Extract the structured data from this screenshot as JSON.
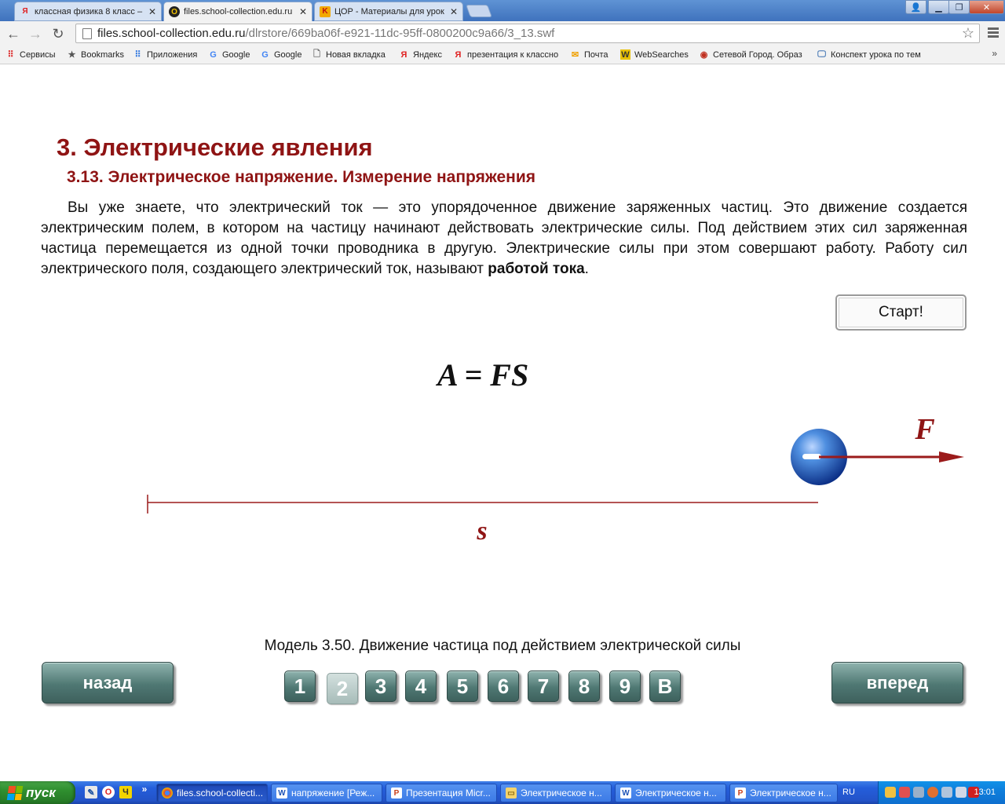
{
  "tabs": [
    {
      "title": "классная физика 8 класс –",
      "favicon": "yandex-icon"
    },
    {
      "title": "files.school-collection.edu.ru",
      "favicon": "collection-icon"
    },
    {
      "title": "ЦОР - Материалы для урок",
      "favicon": "k-icon"
    }
  ],
  "address": {
    "host": "files.school-collection.edu.ru",
    "path": "/dlrstore/669ba06f-e921-11dc-95ff-0800200c9a66/3_13.swf"
  },
  "bookmarks": [
    {
      "label": "Сервисы",
      "icon": "apps-grid-icon"
    },
    {
      "label": "Bookmarks",
      "icon": "star-icon"
    },
    {
      "label": "Приложения",
      "icon": "apps-grid-icon"
    },
    {
      "label": "Google",
      "icon": "google-icon"
    },
    {
      "label": "Google",
      "icon": "google-icon"
    },
    {
      "label": "Новая вкладка",
      "icon": "page-icon"
    },
    {
      "label": "Яндекс",
      "icon": "yandex-icon"
    },
    {
      "label": "презентация к классно",
      "icon": "yandex-icon"
    },
    {
      "label": "Почта",
      "icon": "mail-icon"
    },
    {
      "label": "WebSearches",
      "icon": "websearches-icon"
    },
    {
      "label": "Сетевой Город. Образ",
      "icon": "school-icon"
    },
    {
      "label": "Конспект урока по тем",
      "icon": "monitor-icon"
    }
  ],
  "lesson": {
    "heading": "3. Электрические явления",
    "subheading": "3.13. Электрическое напряжение. Измерение напряжения",
    "paragraph_text": "Вы уже знаете, что электрический ток — это упорядоченное движение заряженных частиц. Это движение создается электрическим полем, в котором на частицу начинают действовать электрические силы. Под действием этих сил заряженная частица перемещается из одной точки проводника в другую. Электрические силы при этом совершают работу. Работу сил электрического поля, создающего электрический ток, называют ",
    "paragraph_bold": "работой тока",
    "paragraph_end": ".",
    "start_button": "Старт!",
    "formula": "A = FS",
    "force_label": "F",
    "distance_label": "s",
    "charge_sign": "−",
    "caption": "Модель 3.50. Движение частица под действием электрической силы"
  },
  "navigation": {
    "back_label": "назад",
    "forward_label": "вперед",
    "pages": [
      "1",
      "2",
      "3",
      "4",
      "5",
      "6",
      "7",
      "8",
      "9",
      "В"
    ],
    "current_page": "2"
  },
  "taskbar": {
    "start_label": "пуск",
    "tasks": [
      {
        "label": "files.school-collecti...",
        "icon": "chrome-icon",
        "active": true
      },
      {
        "label": "напряжение [Реж...",
        "icon": "word-icon",
        "active": false
      },
      {
        "label": "Презентация Micr...",
        "icon": "powerpoint-icon",
        "active": false
      },
      {
        "label": "Электрическое н...",
        "icon": "folder-icon",
        "active": false
      },
      {
        "label": "Электрическое н...",
        "icon": "word-icon",
        "active": false
      },
      {
        "label": "Электрическое н...",
        "icon": "powerpoint-icon",
        "active": false
      }
    ],
    "language": "RU",
    "clock": "13:01"
  },
  "colors": {
    "heading": "#8f1414",
    "nav_button": "#4f7873",
    "taskbar": "#245edb",
    "start_button": "#2f8f2f"
  }
}
